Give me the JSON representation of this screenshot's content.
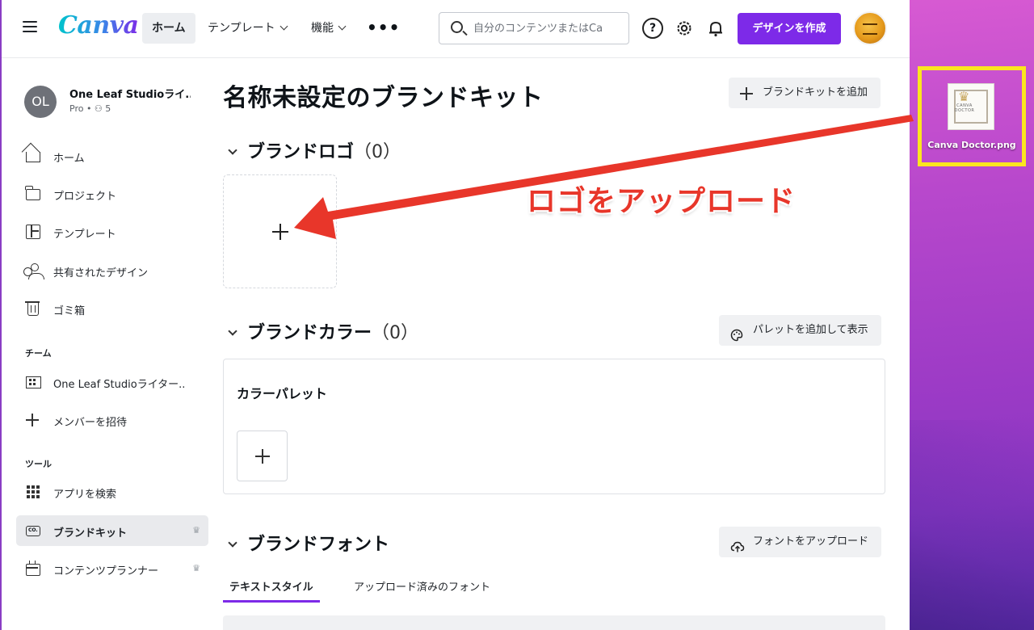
{
  "topbar": {
    "logo": "Canva",
    "nav": {
      "home": "ホーム",
      "templates": "テンプレート",
      "features": "機能",
      "more": "•••"
    },
    "search_placeholder": "自分のコンテンツまたはCa",
    "help": "?",
    "create_label": "デザインを作成"
  },
  "sidebar": {
    "team": {
      "initials": "OL",
      "name": "One Leaf Studioライ..",
      "plan": "Pro • ⚇ 5"
    },
    "items": [
      {
        "label": "ホーム",
        "icon": "home-icon"
      },
      {
        "label": "プロジェクト",
        "icon": "folder-icon"
      },
      {
        "label": "テンプレート",
        "icon": "template-icon"
      },
      {
        "label": "共有されたデザイン",
        "icon": "shared-icon"
      },
      {
        "label": "ゴミ箱",
        "icon": "trash-icon"
      }
    ],
    "team_section": "チーム",
    "team_items": [
      {
        "label": "One Leaf Studioライター..",
        "icon": "building-icon"
      },
      {
        "label": "メンバーを招待",
        "icon": "plus-icon"
      }
    ],
    "tools_section": "ツール",
    "tools_items": [
      {
        "label": "アプリを検索",
        "icon": "apps-icon"
      },
      {
        "label": "ブランドキット",
        "icon": "brand-kit-icon",
        "active": true,
        "crown": "♛"
      },
      {
        "label": "コンテンツプランナー",
        "icon": "calendar-icon",
        "crown": "♛"
      }
    ]
  },
  "main": {
    "title": "名称未設定のブランドキット",
    "add_brandkit": "ブランドキットを追加",
    "logos": {
      "title": "ブランドロゴ",
      "count": "（0）"
    },
    "colors": {
      "title": "ブランドカラー",
      "count": "（0）",
      "add_palette": "パレットを追加して表示",
      "palette_title": "カラーパレット"
    },
    "fonts": {
      "title": "ブランドフォント",
      "upload": "フォントをアップロード",
      "tabs": [
        "テキストスタイル",
        "アップロード済みのフォント"
      ]
    }
  },
  "annotation": {
    "text": "ロゴをアップロード",
    "color": "#e8362a",
    "highlight_color": "#fbe61f"
  },
  "desktop": {
    "file_name": "Canva Doctor.png",
    "thumb_text": "CANVA DOCTOR"
  },
  "colors": {
    "accent": "#7d2ae8"
  }
}
